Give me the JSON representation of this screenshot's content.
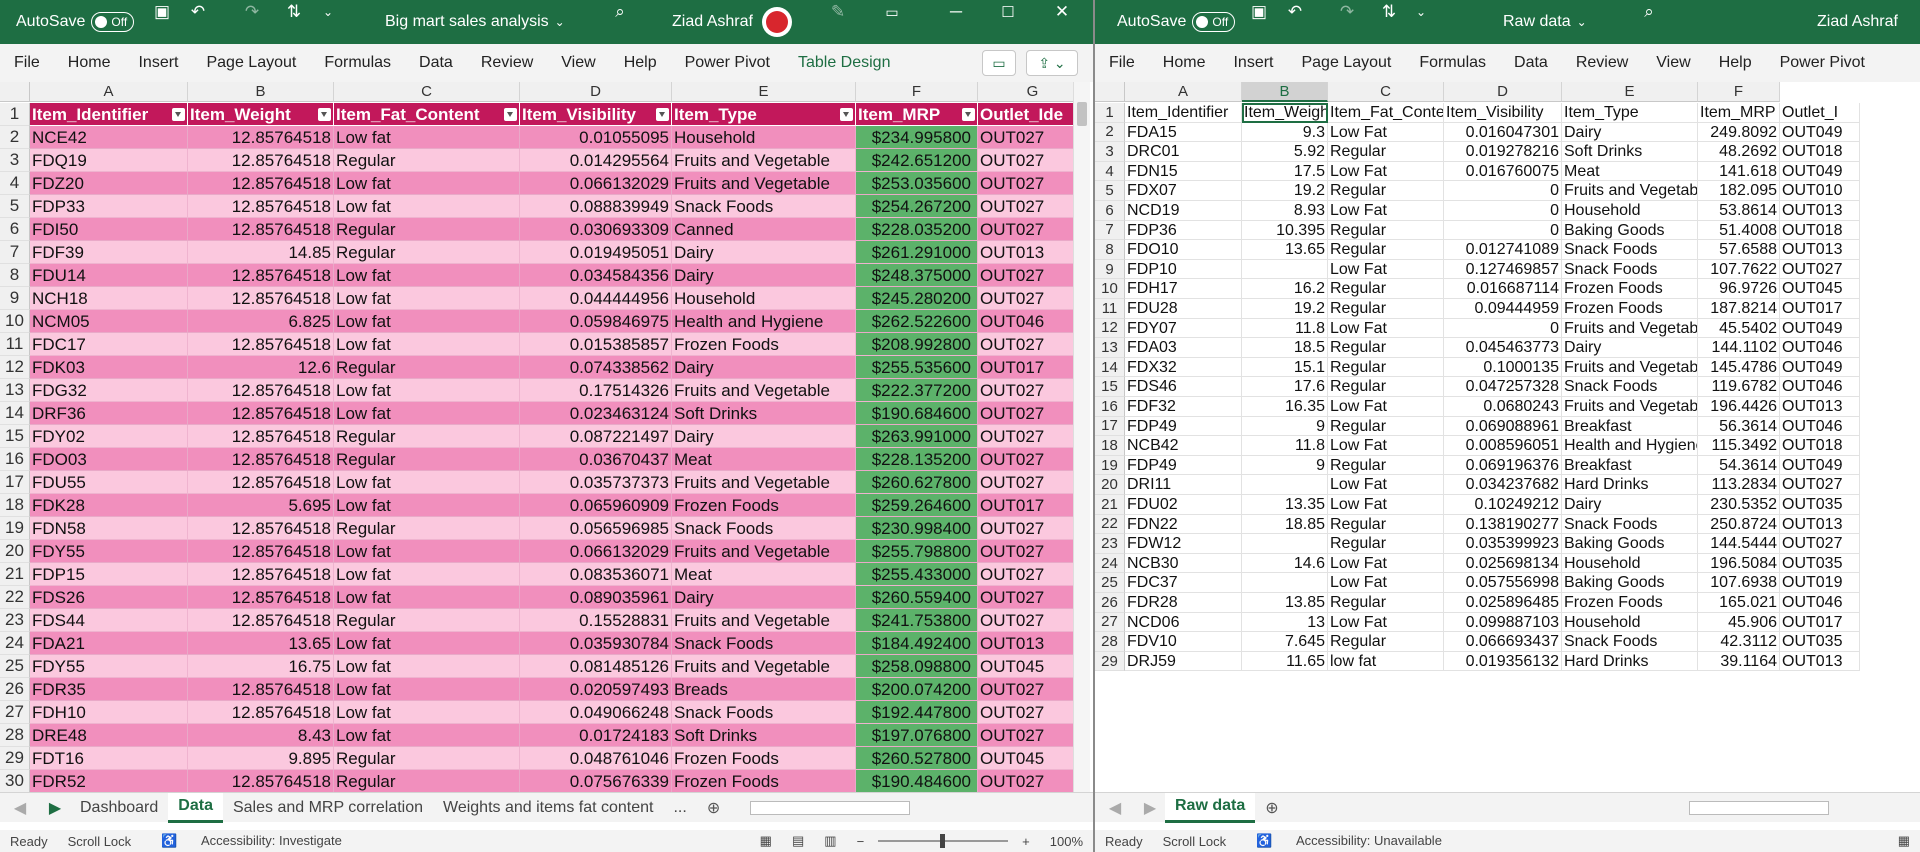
{
  "left": {
    "autosave": "AutoSave",
    "autosave_state": "Off",
    "title": "Big mart sales analysis",
    "user": "Ziad Ashraf",
    "menu": [
      "File",
      "Home",
      "Insert",
      "Page Layout",
      "Formulas",
      "Data",
      "Review",
      "View",
      "Help",
      "Power Pivot",
      "Table Design"
    ],
    "col_letters": [
      "A",
      "B",
      "C",
      "D",
      "E",
      "F",
      "G"
    ],
    "headers": [
      "Item_Identifier",
      "Item_Weight",
      "Item_Fat_Content",
      "Item_Visibility",
      "Item_Type",
      "Item_MRP",
      "Outlet_Ide"
    ],
    "rows": [
      [
        "2",
        "NCE42",
        "12.85764518",
        "Low fat",
        "0.01055095",
        "Household",
        "$234.995800",
        "OUT027"
      ],
      [
        "3",
        "FDQ19",
        "12.85764518",
        "Regular",
        "0.014295564",
        "Fruits and Vegetable",
        "$242.651200",
        "OUT027"
      ],
      [
        "4",
        "FDZ20",
        "12.85764518",
        "Low fat",
        "0.066132029",
        "Fruits and Vegetable",
        "$253.035600",
        "OUT027"
      ],
      [
        "5",
        "FDP33",
        "12.85764518",
        "Low fat",
        "0.088839949",
        "Snack Foods",
        "$254.267200",
        "OUT027"
      ],
      [
        "6",
        "FDI50",
        "12.85764518",
        "Regular",
        "0.030693309",
        "Canned",
        "$228.035200",
        "OUT027"
      ],
      [
        "7",
        "FDF39",
        "14.85",
        "Regular",
        "0.019495051",
        "Dairy",
        "$261.291000",
        "OUT013"
      ],
      [
        "8",
        "FDU14",
        "12.85764518",
        "Low fat",
        "0.034584356",
        "Dairy",
        "$248.375000",
        "OUT027"
      ],
      [
        "9",
        "NCH18",
        "12.85764518",
        "Low fat",
        "0.044444956",
        "Household",
        "$245.280200",
        "OUT027"
      ],
      [
        "10",
        "NCM05",
        "6.825",
        "Low fat",
        "0.059846975",
        "Health and Hygiene",
        "$262.522600",
        "OUT046"
      ],
      [
        "11",
        "FDC17",
        "12.85764518",
        "Low fat",
        "0.015385857",
        "Frozen Foods",
        "$208.992800",
        "OUT027"
      ],
      [
        "12",
        "FDK03",
        "12.6",
        "Regular",
        "0.074338562",
        "Dairy",
        "$255.535600",
        "OUT017"
      ],
      [
        "13",
        "FDG32",
        "12.85764518",
        "Low fat",
        "0.17514326",
        "Fruits and Vegetable",
        "$222.377200",
        "OUT027"
      ],
      [
        "14",
        "DRF36",
        "12.85764518",
        "Low fat",
        "0.023463124",
        "Soft Drinks",
        "$190.684600",
        "OUT027"
      ],
      [
        "15",
        "FDY02",
        "12.85764518",
        "Regular",
        "0.087221497",
        "Dairy",
        "$263.991000",
        "OUT027"
      ],
      [
        "16",
        "FDO03",
        "12.85764518",
        "Regular",
        "0.03670437",
        "Meat",
        "$228.135200",
        "OUT027"
      ],
      [
        "17",
        "FDU55",
        "12.85764518",
        "Low fat",
        "0.035737373",
        "Fruits and Vegetable",
        "$260.627800",
        "OUT027"
      ],
      [
        "18",
        "FDK28",
        "5.695",
        "Low fat",
        "0.065960909",
        "Frozen Foods",
        "$259.264600",
        "OUT017"
      ],
      [
        "19",
        "FDN58",
        "12.85764518",
        "Regular",
        "0.056596985",
        "Snack Foods",
        "$230.998400",
        "OUT027"
      ],
      [
        "20",
        "FDY55",
        "12.85764518",
        "Low fat",
        "0.066132029",
        "Fruits and Vegetable",
        "$255.798800",
        "OUT027"
      ],
      [
        "21",
        "FDP15",
        "12.85764518",
        "Low fat",
        "0.083536071",
        "Meat",
        "$255.433000",
        "OUT027"
      ],
      [
        "22",
        "FDS26",
        "12.85764518",
        "Low fat",
        "0.089035961",
        "Dairy",
        "$260.559400",
        "OUT027"
      ],
      [
        "23",
        "FDS44",
        "12.85764518",
        "Regular",
        "0.15528831",
        "Fruits and Vegetable",
        "$241.753800",
        "OUT027"
      ],
      [
        "24",
        "FDA21",
        "13.65",
        "Low fat",
        "0.035930784",
        "Snack Foods",
        "$184.492400",
        "OUT013"
      ],
      [
        "25",
        "FDY55",
        "16.75",
        "Low fat",
        "0.081485126",
        "Fruits and Vegetable",
        "$258.098800",
        "OUT045"
      ],
      [
        "26",
        "FDR35",
        "12.85764518",
        "Low fat",
        "0.020597493",
        "Breads",
        "$200.074200",
        "OUT027"
      ],
      [
        "27",
        "FDH10",
        "12.85764518",
        "Low fat",
        "0.049066248",
        "Snack Foods",
        "$192.447800",
        "OUT027"
      ],
      [
        "28",
        "DRE48",
        "8.43",
        "Low fat",
        "0.01724183",
        "Soft Drinks",
        "$197.076800",
        "OUT027"
      ],
      [
        "29",
        "FDT16",
        "9.895",
        "Regular",
        "0.048761046",
        "Frozen Foods",
        "$260.527800",
        "OUT045"
      ],
      [
        "30",
        "FDR52",
        "12.85764518",
        "Regular",
        "0.075676339",
        "Frozen Foods",
        "$190.484600",
        "OUT027"
      ]
    ],
    "tabs": [
      "Dashboard",
      "Data",
      "Sales and MRP correlation",
      "Weights and items fat content"
    ],
    "active_tab": "Data",
    "tab_more": "...",
    "status": [
      "Ready",
      "Scroll Lock",
      "Accessibility: Investigate"
    ],
    "zoom": "100%"
  },
  "right": {
    "autosave": "AutoSave",
    "autosave_state": "Off",
    "title": "Raw data",
    "user": "Ziad Ashraf",
    "menu": [
      "File",
      "Home",
      "Insert",
      "Page Layout",
      "Formulas",
      "Data",
      "Review",
      "View",
      "Help",
      "Power Pivot"
    ],
    "col_letters": [
      "A",
      "B",
      "C",
      "D",
      "E",
      "F"
    ],
    "selected_col": "B",
    "rows": [
      [
        "1",
        "Item_Identifier",
        "Item_Weight",
        "Item_Fat_Content",
        "Item_Visibility",
        "Item_Type",
        "Item_MRP",
        "Outlet_I"
      ],
      [
        "2",
        "FDA15",
        "9.3",
        "Low Fat",
        "0.016047301",
        "Dairy",
        "249.8092",
        "OUT049"
      ],
      [
        "3",
        "DRC01",
        "5.92",
        "Regular",
        "0.019278216",
        "Soft Drinks",
        "48.2692",
        "OUT018"
      ],
      [
        "4",
        "FDN15",
        "17.5",
        "Low Fat",
        "0.016760075",
        "Meat",
        "141.618",
        "OUT049"
      ],
      [
        "5",
        "FDX07",
        "19.2",
        "Regular",
        "0",
        "Fruits and Vegetables",
        "182.095",
        "OUT010"
      ],
      [
        "6",
        "NCD19",
        "8.93",
        "Low Fat",
        "0",
        "Household",
        "53.8614",
        "OUT013"
      ],
      [
        "7",
        "FDP36",
        "10.395",
        "Regular",
        "0",
        "Baking Goods",
        "51.4008",
        "OUT018"
      ],
      [
        "8",
        "FDO10",
        "13.65",
        "Regular",
        "0.012741089",
        "Snack Foods",
        "57.6588",
        "OUT013"
      ],
      [
        "9",
        "FDP10",
        "",
        "Low Fat",
        "0.127469857",
        "Snack Foods",
        "107.7622",
        "OUT027"
      ],
      [
        "10",
        "FDH17",
        "16.2",
        "Regular",
        "0.016687114",
        "Frozen Foods",
        "96.9726",
        "OUT045"
      ],
      [
        "11",
        "FDU28",
        "19.2",
        "Regular",
        "0.09444959",
        "Frozen Foods",
        "187.8214",
        "OUT017"
      ],
      [
        "12",
        "FDY07",
        "11.8",
        "Low Fat",
        "0",
        "Fruits and Vegetables",
        "45.5402",
        "OUT049"
      ],
      [
        "13",
        "FDA03",
        "18.5",
        "Regular",
        "0.045463773",
        "Dairy",
        "144.1102",
        "OUT046"
      ],
      [
        "14",
        "FDX32",
        "15.1",
        "Regular",
        "0.1000135",
        "Fruits and Vegetables",
        "145.4786",
        "OUT049"
      ],
      [
        "15",
        "FDS46",
        "17.6",
        "Regular",
        "0.047257328",
        "Snack Foods",
        "119.6782",
        "OUT046"
      ],
      [
        "16",
        "FDF32",
        "16.35",
        "Low Fat",
        "0.0680243",
        "Fruits and Vegetables",
        "196.4426",
        "OUT013"
      ],
      [
        "17",
        "FDP49",
        "9",
        "Regular",
        "0.069088961",
        "Breakfast",
        "56.3614",
        "OUT046"
      ],
      [
        "18",
        "NCB42",
        "11.8",
        "Low Fat",
        "0.008596051",
        "Health and Hygiene",
        "115.3492",
        "OUT018"
      ],
      [
        "19",
        "FDP49",
        "9",
        "Regular",
        "0.069196376",
        "Breakfast",
        "54.3614",
        "OUT049"
      ],
      [
        "20",
        "DRI11",
        "",
        "Low Fat",
        "0.034237682",
        "Hard Drinks",
        "113.2834",
        "OUT027"
      ],
      [
        "21",
        "FDU02",
        "13.35",
        "Low Fat",
        "0.10249212",
        "Dairy",
        "230.5352",
        "OUT035"
      ],
      [
        "22",
        "FDN22",
        "18.85",
        "Regular",
        "0.138190277",
        "Snack Foods",
        "250.8724",
        "OUT013"
      ],
      [
        "23",
        "FDW12",
        "",
        "Regular",
        "0.035399923",
        "Baking Goods",
        "144.5444",
        "OUT027"
      ],
      [
        "24",
        "NCB30",
        "14.6",
        "Low Fat",
        "0.025698134",
        "Household",
        "196.5084",
        "OUT035"
      ],
      [
        "25",
        "FDC37",
        "",
        "Low Fat",
        "0.057556998",
        "Baking Goods",
        "107.6938",
        "OUT019"
      ],
      [
        "26",
        "FDR28",
        "13.85",
        "Regular",
        "0.025896485",
        "Frozen Foods",
        "165.021",
        "OUT046"
      ],
      [
        "27",
        "NCD06",
        "13",
        "Low Fat",
        "0.099887103",
        "Household",
        "45.906",
        "OUT017"
      ],
      [
        "28",
        "FDV10",
        "7.645",
        "Regular",
        "0.066693437",
        "Snack Foods",
        "42.3112",
        "OUT035"
      ],
      [
        "29",
        "DRJ59",
        "11.65",
        "low fat",
        "0.019356132",
        "Hard Drinks",
        "39.1164",
        "OUT013"
      ]
    ],
    "tabs": [
      "Raw data"
    ],
    "active_tab": "Raw data",
    "status": [
      "Ready",
      "Scroll Lock",
      "Accessibility: Unavailable"
    ]
  },
  "colors": {
    "excel_green": "#1e6e43",
    "header_magenta": "#c2185b",
    "row_dark": "#f18fbd",
    "row_light": "#fbc8de",
    "mrp_green": "#5cb26a"
  }
}
